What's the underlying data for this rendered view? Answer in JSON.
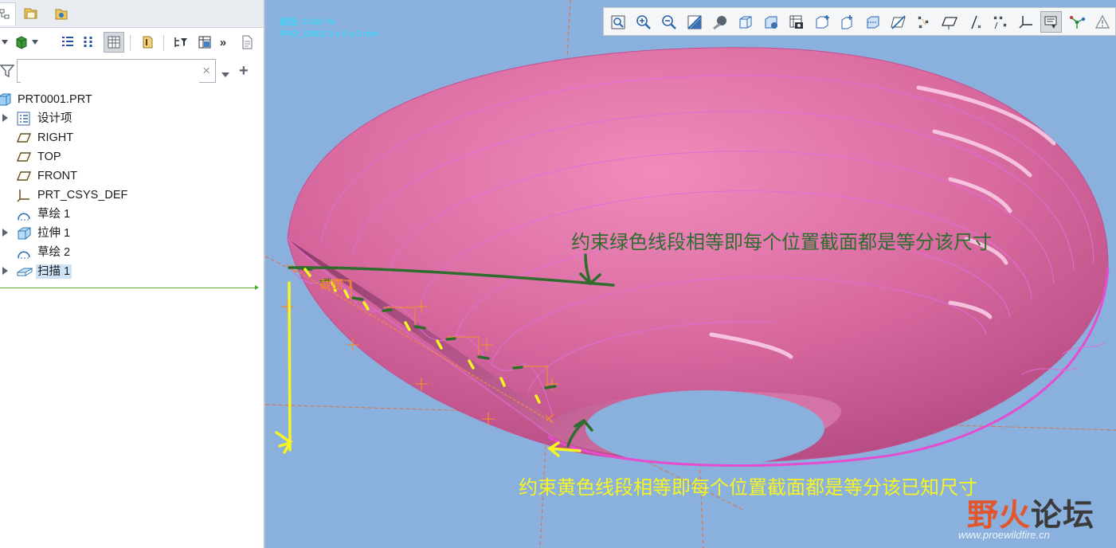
{
  "tree": {
    "search_placeholder": "",
    "items": [
      {
        "label": "PRT0001.PRT",
        "icon": "part-icon"
      },
      {
        "label": "设计项",
        "icon": "design-items-icon"
      },
      {
        "label": "RIGHT",
        "icon": "datum-plane-icon"
      },
      {
        "label": "TOP",
        "icon": "datum-plane-icon"
      },
      {
        "label": "FRONT",
        "icon": "datum-plane-icon"
      },
      {
        "label": "PRT_CSYS_DEF",
        "icon": "csys-icon"
      },
      {
        "label": "草绘 1",
        "icon": "sketch-icon"
      },
      {
        "label": "拉伸 1",
        "icon": "extrude-icon"
      },
      {
        "label": "草绘 2",
        "icon": "sketch-icon"
      },
      {
        "label": "扫描 1",
        "icon": "sweep-icon"
      }
    ]
  },
  "viewport": {
    "status_line1": "截面: 0.000 %",
    "status_line2": "PRO_DIMS 0 x 0 x 0 mm",
    "section_label": "截面 1"
  },
  "annotations": {
    "green_note": "约束绿色线段相等即每个位置截面都是等分该尺寸",
    "yellow_note": "约束黄色线段相等即每个位置截面都是等分该已知尺寸"
  },
  "watermark": {
    "title_part1": "野火",
    "title_part2": "论坛",
    "url": "www.proewildfire.cn"
  },
  "colors": {
    "viewport_bg": "#8ab0dd",
    "surface": "#d96aa0",
    "green_note": "#2f6d2f",
    "yellow_note": "#f6f422",
    "watermark_red": "#e3552d",
    "watermark_dark": "#3b3b3b"
  }
}
